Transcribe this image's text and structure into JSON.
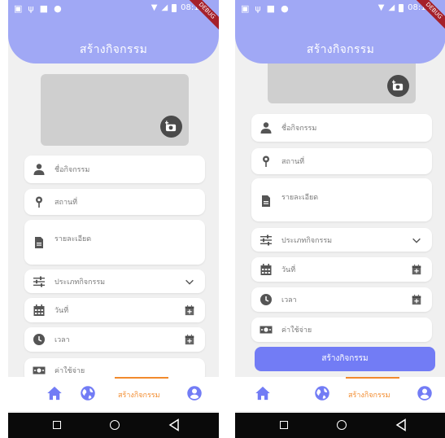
{
  "left": {
    "status": {
      "time": "08:19",
      "ribbon": "DEBUG"
    },
    "title": "สร้างกิจกรรม",
    "fields": {
      "name": "ชื่อกิจกรรม",
      "place": "สถานที่",
      "detail": "รายละเอียด",
      "type": "ประเภทกิจกรรม",
      "date": "วันที่",
      "time": "เวลา",
      "cost": "ค่าใช้จ่าย"
    },
    "nav": {
      "create_label": "สร้างกิจกรรม"
    }
  },
  "right": {
    "status": {
      "time": "08:19",
      "ribbon": "DEBUG"
    },
    "title": "สร้างกิจกรรม",
    "fields": {
      "name": "ชื่อกิจกรรม",
      "place": "สถานที่",
      "detail": "รายละเอียด",
      "type": "ประเภทกิจกรรม",
      "date": "วันที่",
      "time": "เวลา",
      "cost": "ค่าใช้จ่าย"
    },
    "submit_label": "สร้างกิจกรรม",
    "nav": {
      "create_label": "สร้างกิจกรรม"
    }
  },
  "colors": {
    "header": "#a0a8f5",
    "button": "#727cf5",
    "accent": "#f28a2c",
    "nav_icon": "#727cf5"
  }
}
